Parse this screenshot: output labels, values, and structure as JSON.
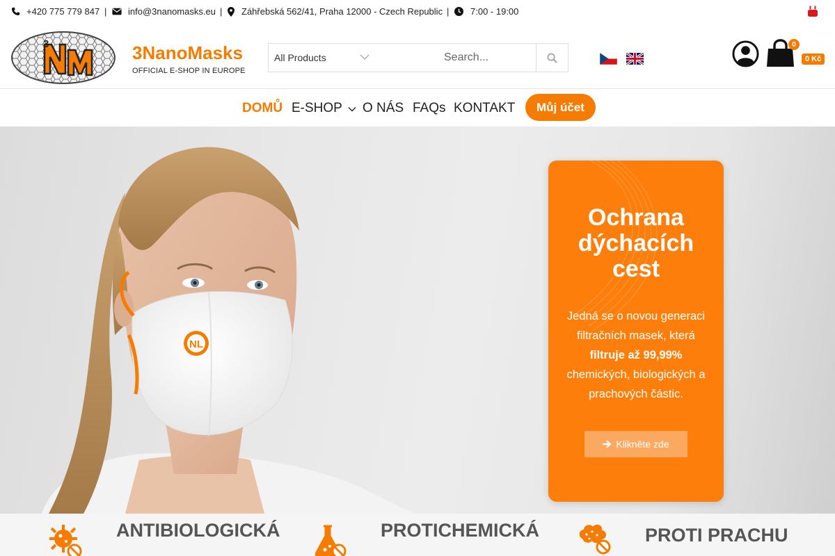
{
  "topbar": {
    "phone": "+420 775 779 847",
    "email": "info@3nanomasks.eu",
    "address": "Záhřebská 562/41, Praha 12000 - Czech Republic",
    "hours": "7:00 - 19:00",
    "separator": "|"
  },
  "header": {
    "brand_name": "3NanoMasks",
    "tagline": "OFFICIAL E-SHOP IN EUROPE",
    "search": {
      "category": "All Products",
      "placeholder": "Search..."
    },
    "cart": {
      "count": "0",
      "total": "0 Kč"
    }
  },
  "nav": {
    "items": [
      {
        "label": "DOMŮ",
        "active": true
      },
      {
        "label": "E-SHOP",
        "dropdown": true
      },
      {
        "label": "O NÁS"
      },
      {
        "label": "FAQs"
      },
      {
        "label": "KONTAKT"
      }
    ],
    "account_button": "Můj účet"
  },
  "hero": {
    "card": {
      "title_line1": "Ochrana",
      "title_line2": "dýchacích",
      "title_line3": "cest",
      "text_before": "Jedná se o novou generaci filtračních masek, která",
      "text_bold": "filtruje až 99,99%",
      "text_after": "chemických, biologických a prachových částic.",
      "button_label": "Klikněte zde"
    }
  },
  "features": [
    {
      "label": "ANTIBIOLOGICKÁ",
      "icon": "virus-blocked-icon"
    },
    {
      "label": "PROTICHEMICKÁ",
      "icon": "flask-blocked-icon"
    },
    {
      "label": "PROTI PRACHU",
      "icon": "dust-blocked-icon"
    }
  ],
  "colors": {
    "accent": "#f57c00",
    "card": "#fd7e0b",
    "card_button": "#fba860"
  }
}
